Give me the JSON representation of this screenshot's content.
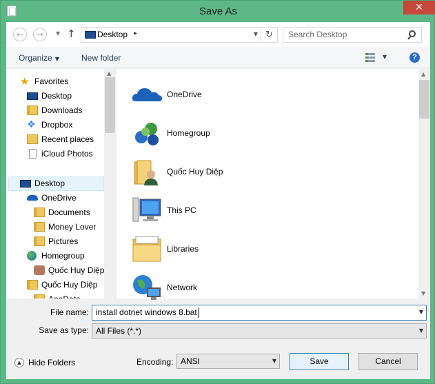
{
  "window": {
    "title": "Save As",
    "close_glyph": "✕"
  },
  "navbar": {
    "back_glyph": "←",
    "forward_glyph": "→",
    "up_glyph": "↑",
    "address": "Desktop",
    "refresh_glyph": "↻",
    "search_placeholder": "Search Desktop"
  },
  "toolbar": {
    "organize_label": "Organize",
    "new_folder_label": "New folder",
    "help_glyph": "?"
  },
  "navpane": {
    "items": [
      {
        "label": "Favorites",
        "icon": "star-icon"
      },
      {
        "label": "Desktop",
        "icon": "desktop-icon"
      },
      {
        "label": "Downloads",
        "icon": "folder-icon"
      },
      {
        "label": "Dropbox",
        "icon": "dropbox-icon"
      },
      {
        "label": "Recent places",
        "icon": "recent-places-icon"
      },
      {
        "label": "iCloud Photos",
        "icon": "document-icon"
      },
      {
        "label": "Desktop",
        "icon": "desktop-icon"
      },
      {
        "label": "OneDrive",
        "icon": "onedrive-icon"
      },
      {
        "label": "Documents",
        "icon": "folder-icon"
      },
      {
        "label": "Money Lover",
        "icon": "folder-icon"
      },
      {
        "label": "Pictures",
        "icon": "folder-icon"
      },
      {
        "label": "Homegroup",
        "icon": "homegroup-icon"
      },
      {
        "label": "Quốc Huy Diệp",
        "icon": "user-avatar-icon"
      },
      {
        "label": "Quốc Huy Diệp",
        "icon": "user-folder-icon"
      },
      {
        "label": "AppData",
        "icon": "folder-icon"
      }
    ]
  },
  "filelist": {
    "items": [
      {
        "label": "OneDrive",
        "icon": "onedrive-icon"
      },
      {
        "label": "Homegroup",
        "icon": "homegroup-icon"
      },
      {
        "label": "Quốc Huy Diệp",
        "icon": "user-folder-icon"
      },
      {
        "label": "This PC",
        "icon": "this-pc-icon"
      },
      {
        "label": "Libraries",
        "icon": "libraries-icon"
      },
      {
        "label": "Network",
        "icon": "network-icon"
      }
    ]
  },
  "form": {
    "file_name_label": "File name:",
    "file_name_value": "install dotnet windows 8.bat",
    "save_as_type_label": "Save as type:",
    "save_as_type_value": "All Files  (*.*)",
    "encoding_label": "Encoding:",
    "encoding_value": "ANSI"
  },
  "footer": {
    "hide_folders_label": "Hide Folders",
    "save_label": "Save",
    "cancel_label": "Cancel"
  },
  "colors": {
    "window_frame": "#5db887",
    "close_button": "#c7473b",
    "selection": "#e5f3fb",
    "focus_border": "#3c7fb1"
  }
}
